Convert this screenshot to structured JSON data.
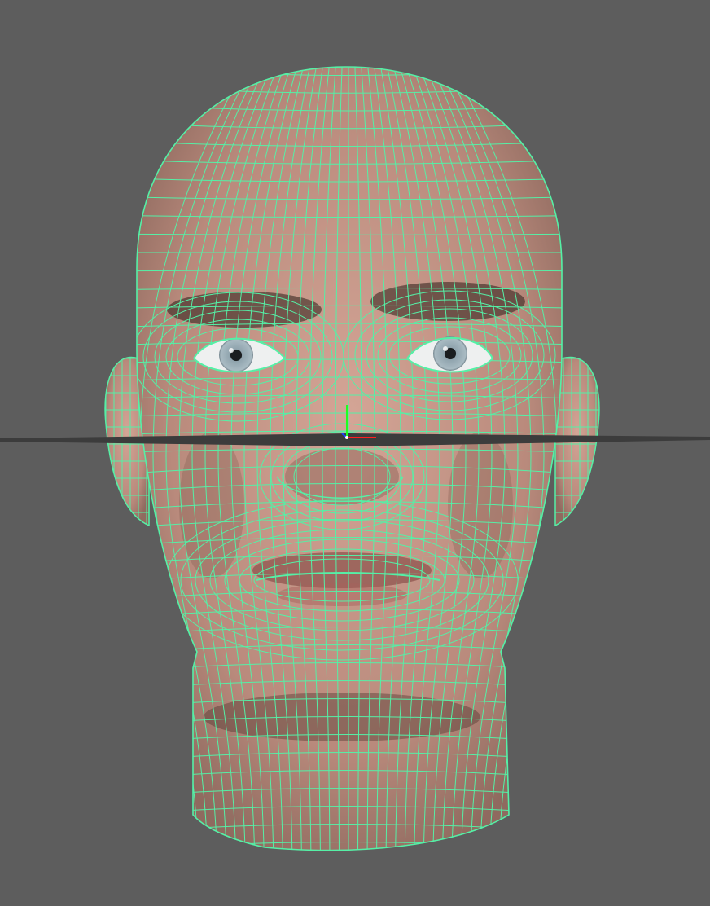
{
  "viewport": {
    "background_color": "#5d5d5d",
    "wireframe_color": "#55f0a6",
    "skin_color": "#c8998a",
    "iris_color": "#9fb1ba",
    "ground_plane_color": "#3c3c3c"
  },
  "model": {
    "display_mode": "wireframe-on-shaded",
    "subject_icon": "head-mesh-icon"
  },
  "gizmo": {
    "axes": [
      {
        "name": "x-axis-icon",
        "color": "#ff2020"
      },
      {
        "name": "y-axis-icon",
        "color": "#20ff20"
      },
      {
        "name": "z-axis-icon",
        "color": "#2040ff"
      }
    ]
  }
}
